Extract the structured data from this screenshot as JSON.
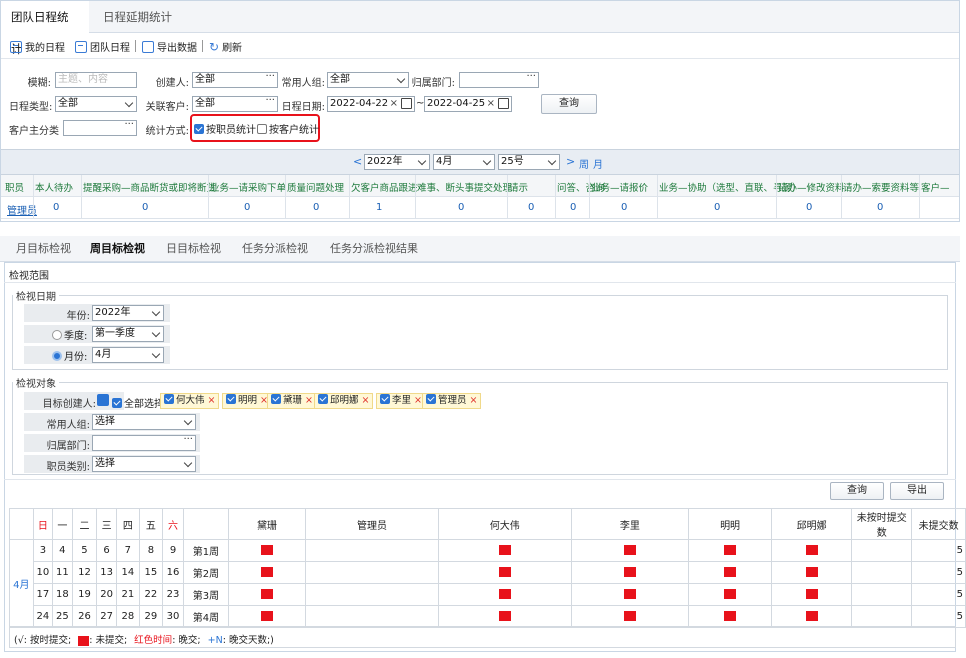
{
  "top_tabs": [
    {
      "label": "团队日程统计",
      "active": true
    },
    {
      "label": "日程延期统计",
      "active": false
    }
  ],
  "toolbar": {
    "my_schedule": "我的日程",
    "team_schedule": "团队日程",
    "export": "导出数据",
    "refresh": "刷新"
  },
  "filters": {
    "fuzzy_label": "模糊:",
    "fuzzy_placeholder": "主题、内容",
    "creator_label": "创建人:",
    "creator_value": "全部",
    "usergroup_label": "常用人组:",
    "usergroup_value": "全部",
    "dept_label": "归属部门:",
    "dept_value": "",
    "type_label": "日程类型:",
    "type_value": "全部",
    "customer_label": "关联客户:",
    "customer_value": "全部",
    "date_label": "日程日期:",
    "date_from": "2022-04-22",
    "date_to": "2022-04-25",
    "date_sep": "~",
    "query_label": "查询",
    "cust_cat_label": "客户主分类",
    "cust_cat_value": "",
    "method_label": "统计方式:",
    "by_staff": "按职员统计",
    "by_customer": "按客户统计"
  },
  "period_nav": {
    "prev": "<",
    "year": "2022年",
    "month": "4月",
    "day": "25号",
    "next": ">",
    "week": "周",
    "month_btn": "月"
  },
  "stats_table": {
    "headers": [
      "职员",
      "本人待办",
      "提醒采购—商品断货或即将断货",
      "业务—请采购下单",
      "质量问题处理",
      "欠客户商品跟进",
      "难事、断头事提交处理",
      "请示",
      "问答、咨询",
      "业务—请报价",
      "业务—协助（选型、直联、寻源）",
      "请办—修改资料",
      "请办—索要资料等",
      "客户—"
    ],
    "row": {
      "name": "管理员",
      "values": [
        "0",
        "0",
        "0",
        "0",
        "1",
        "0",
        "0",
        "0",
        "0",
        "0",
        "0",
        "0"
      ]
    }
  },
  "lower_tabs": [
    {
      "label": "月目标检视",
      "active": false
    },
    {
      "label": "周目标检视",
      "active": true
    },
    {
      "label": "日目标检视",
      "active": false
    },
    {
      "label": "任务分派检视",
      "active": false
    },
    {
      "label": "任务分派检视结果",
      "active": false
    }
  ],
  "scope": {
    "title": "检视范围",
    "date_legend": "检视日期",
    "year_label": "年份:",
    "year_value": "2022年",
    "quarter_label": "季度:",
    "quarter_value": "第一季度",
    "month_label": "月份:",
    "month_value": "4月",
    "target_legend": "检视对象",
    "creator_label": "目标创建人:",
    "select_all": "全部选择",
    "people": [
      "何大伟",
      "明明",
      "黛珊",
      "邱明娜",
      "李里",
      "管理员"
    ],
    "group_label": "常用人组:",
    "group_value": "选择",
    "dept_label": "归属部门:",
    "dept_value": "",
    "category_label": "职员类别:",
    "category_value": "选择"
  },
  "actions": {
    "query": "查询",
    "export": "导出"
  },
  "calendar": {
    "weekdays": [
      "日",
      "一",
      "二",
      "三",
      "四",
      "五",
      "六"
    ],
    "month": "4月",
    "person_cols": [
      "黛珊",
      "管理员",
      "何大伟",
      "李里",
      "明明",
      "邱明娜"
    ],
    "late_col": "未按时提交数",
    "unsubmitted_col": "未提交数",
    "weeks": [
      {
        "days": [
          "3",
          "4",
          "5",
          "6",
          "7",
          "8",
          "9"
        ],
        "label": "第1周",
        "marks": [
          true,
          false,
          true,
          true,
          true,
          true
        ],
        "late": "",
        "unsub": "5"
      },
      {
        "days": [
          "10",
          "11",
          "12",
          "13",
          "14",
          "15",
          "16"
        ],
        "label": "第2周",
        "marks": [
          true,
          false,
          true,
          true,
          true,
          true
        ],
        "late": "",
        "unsub": "5"
      },
      {
        "days": [
          "17",
          "18",
          "19",
          "20",
          "21",
          "22",
          "23"
        ],
        "label": "第3周",
        "marks": [
          true,
          false,
          true,
          true,
          true,
          true
        ],
        "late": "",
        "unsub": "5"
      },
      {
        "days": [
          "24",
          "25",
          "26",
          "27",
          "28",
          "29",
          "30"
        ],
        "label": "第4周",
        "marks": [
          true,
          false,
          true,
          true,
          true,
          true
        ],
        "late": "",
        "unsub": "5"
      }
    ]
  },
  "legend": {
    "on_time": "(√: 按时提交;",
    "unsubmitted": ": 未提交;",
    "red_time": "红色时间",
    "late": ": 晚交;",
    "plus_n": "+N",
    "late_days": ": 晚交天数;)"
  },
  "colors": {
    "accent": "#2a74d4",
    "mark": "#e8121b",
    "highlight_border": "#e8121b",
    "header_green": "#1e7a3c"
  }
}
